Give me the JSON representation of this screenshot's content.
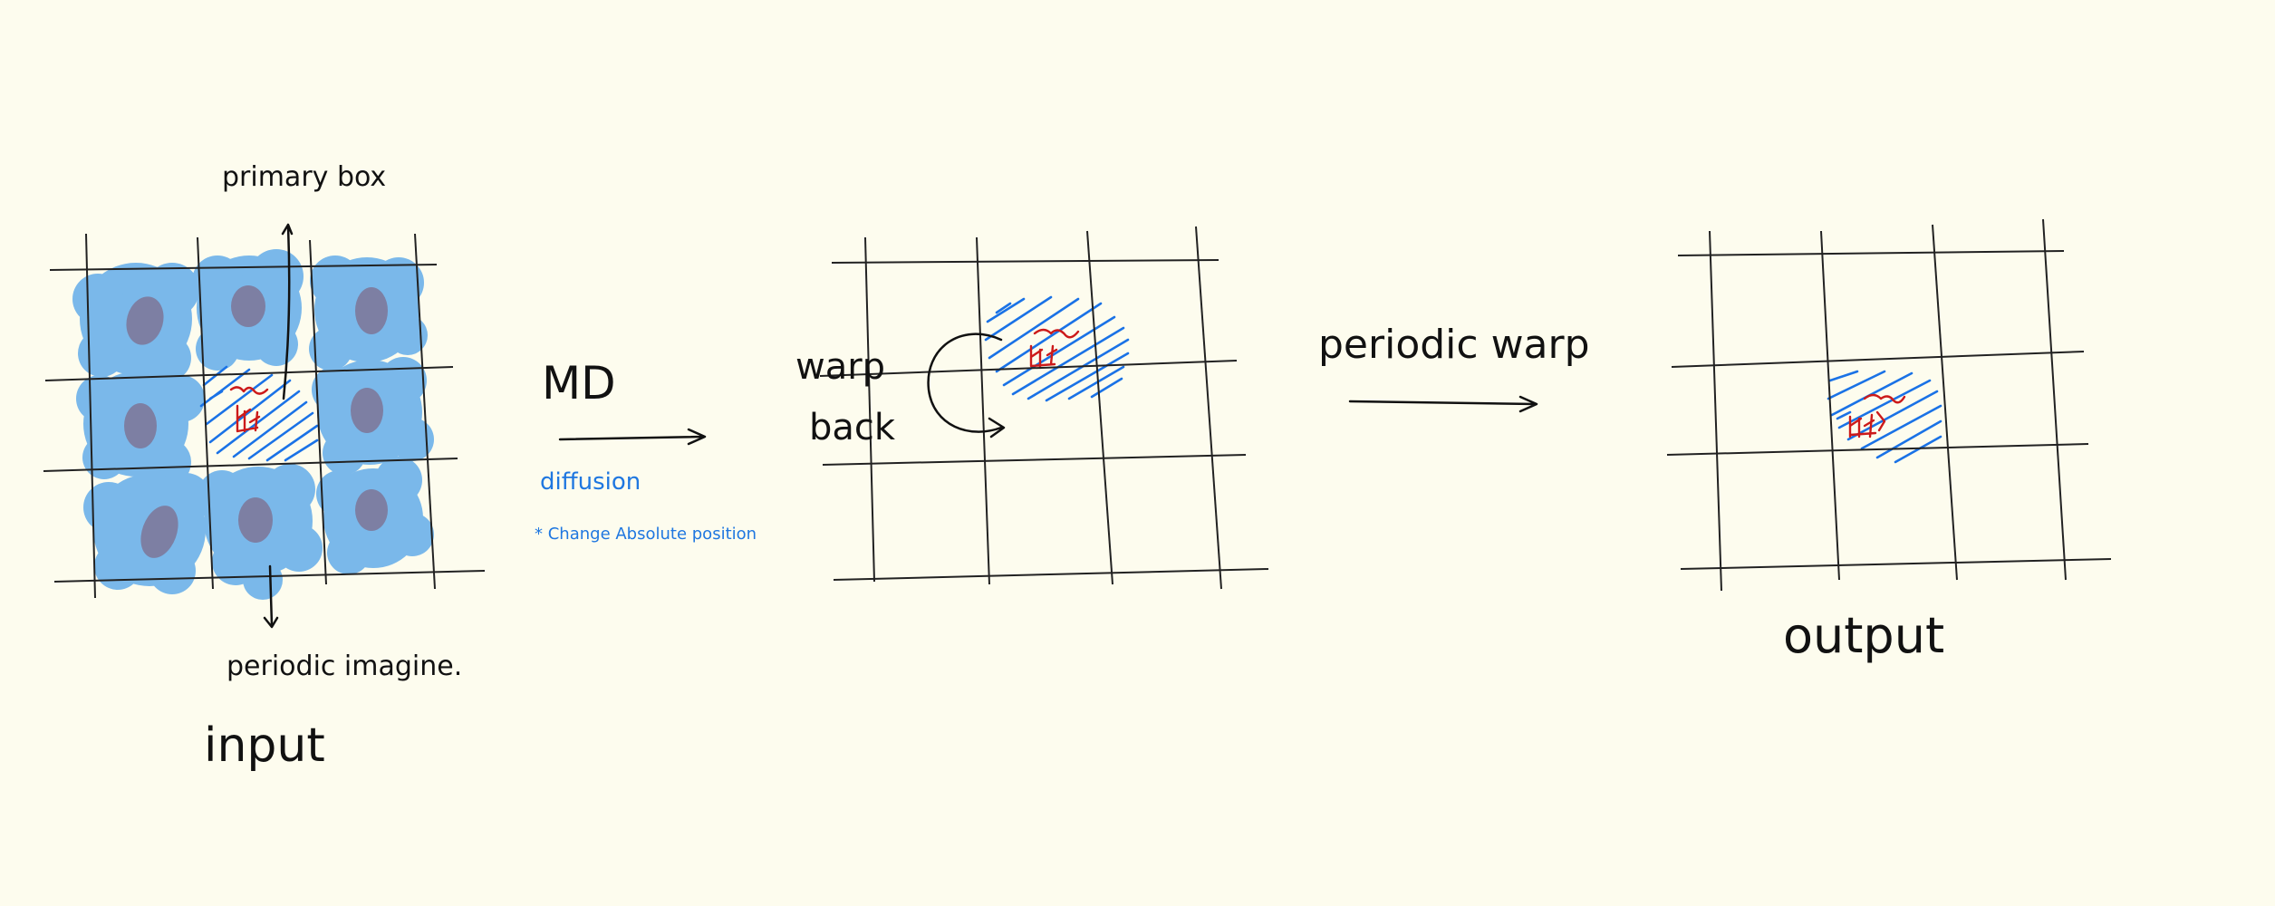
{
  "colors": {
    "background": "#fdfcee",
    "ink": "#111111",
    "blue_ink": "#1a72e6",
    "blob_blue": "#7ab8ea",
    "core_purple": "#7d7fa3",
    "red_ink": "#cc1a1a"
  },
  "labels": {
    "primary_box": "primary box",
    "periodic_image": "periodic imagine.",
    "input": "input",
    "md": "MD",
    "diffusion": "diffusion",
    "note": "* Change Absolute position",
    "warp_back_1": "warp",
    "warp_back_2": "back",
    "periodic_warp": "periodic warp",
    "output": "output"
  }
}
